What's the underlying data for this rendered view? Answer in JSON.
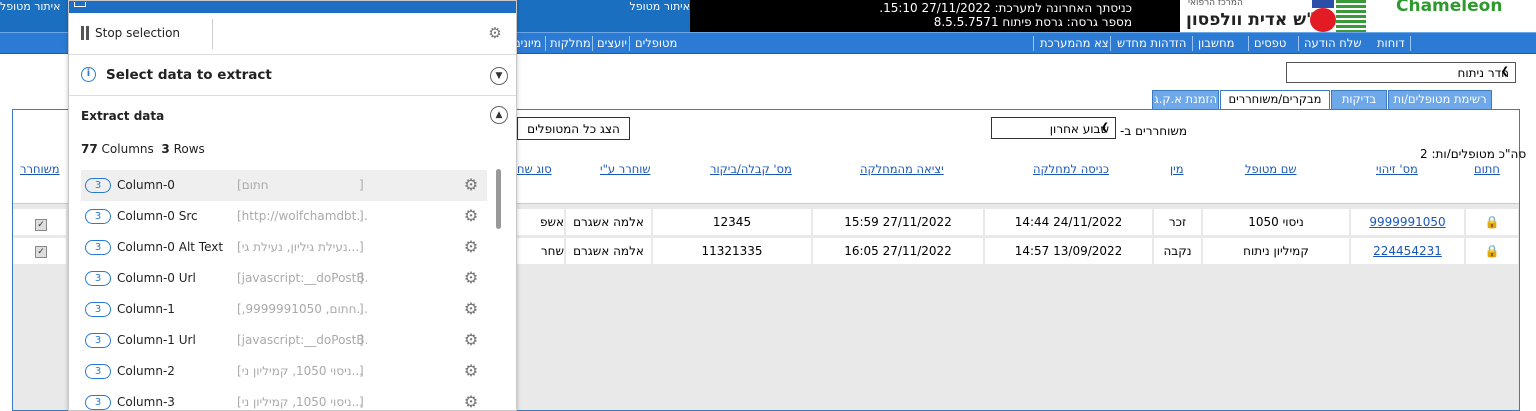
{
  "header": {
    "app_title": "איתור מטופל",
    "last_login": "כניסתך האחרונה למערכת: 27/11/2022 15:10.",
    "version": "מספר גרסה: גרסת פיתוח 8.5.5.7571",
    "org_name": "ע\"ש אדית וולפסון",
    "org_small": "המרכז הרפואי",
    "brand": "Chameleon"
  },
  "nav": {
    "items": [
      "דוחות",
      "שלח הודעה",
      "טפסים",
      "מחשבון",
      "הזדהות מחדש",
      "צא מהמערכת",
      "מטופלים",
      "יועצים",
      "מחלקות",
      "מיונים"
    ]
  },
  "department": {
    "value": "חדר ניתוח"
  },
  "tabs": [
    "רשימת מטופלים/ות",
    "בדיקות",
    "מבקרים/משוחררים",
    "הזמנת א.ק.ג"
  ],
  "filters": {
    "released_label": "משוחררים ב-",
    "released_value": "שבוע אחרון",
    "show_all": "הצג כל המטופלים",
    "count_label": "סה\"כ מטופלים/ות: 2"
  },
  "table": {
    "columns": [
      "חתום",
      "מס' זיהוי",
      "שם מטופל",
      "מין",
      "כניסה למחלקה",
      "יציאה מהמחלקה",
      "מס' קבלה/ביקור",
      "שוחרר ע\"י",
      "סוג שח",
      "משוחרר"
    ],
    "rows": [
      {
        "id": "9999991050",
        "name": "ניסוי 1050",
        "sex": "זכר",
        "admit": "24/11/2022 14:44",
        "discharge": "27/11/2022 15:59",
        "visit": "12345",
        "released_by": "אלמה אשגרם",
        "release_type": "אשפ"
      },
      {
        "id": "224454231",
        "name": "קמיליון ניתוח",
        "sex": "נקבה",
        "admit": "13/09/2022 14:57",
        "discharge": "27/11/2022 16:05",
        "visit": "11321335",
        "released_by": "אלמה אשגרם",
        "release_type": "שחר"
      }
    ]
  },
  "extract_panel": {
    "stop_label": "Stop selection",
    "select_title": "Select data to extract",
    "extract_title": "Extract data",
    "columns_count": "77",
    "columns_word": "Columns",
    "rows_count": "3",
    "rows_word": "Rows",
    "items": [
      {
        "count": "3",
        "name": "Column-0",
        "value": "[חתום"
      },
      {
        "count": "3",
        "name": "Column-0 Src",
        "value": "[http://wolfchamdbt..."
      },
      {
        "count": "3",
        "name": "Column-0 Alt Text",
        "value": "[נעילת גיליון, נעילת גי..."
      },
      {
        "count": "3",
        "name": "Column-0 Url",
        "value": "[javascript:__doPostB..."
      },
      {
        "count": "3",
        "name": "Column-1",
        "value": "[,9999991050 ,חתום..."
      },
      {
        "count": "3",
        "name": "Column-1 Url",
        "value": "[javascript:__doPostB..."
      },
      {
        "count": "3",
        "name": "Column-2",
        "value": "[ניסוי 1050, קמיליון ני..."
      },
      {
        "count": "3",
        "name": "Column-3",
        "value": "[ניסוי 1050, קמיליון ני..."
      }
    ]
  }
}
